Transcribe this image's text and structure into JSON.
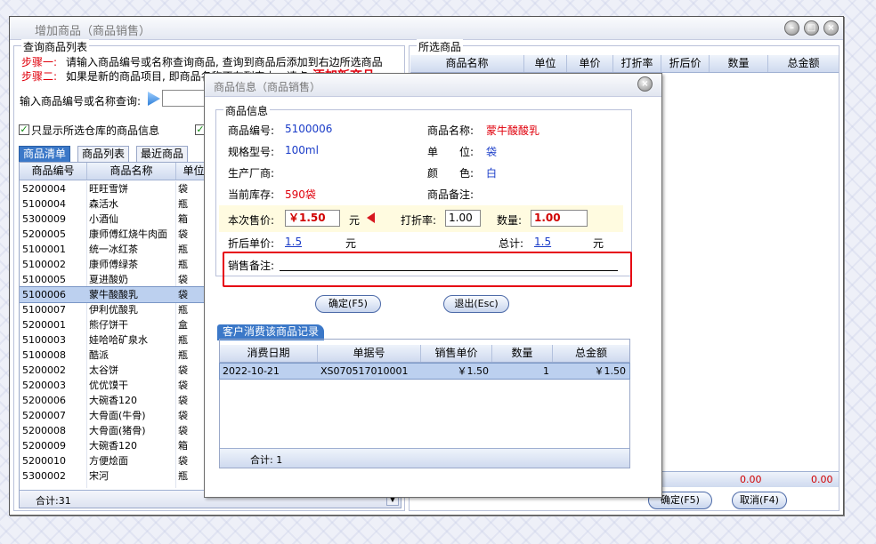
{
  "main": {
    "title": "增加商品（商品销售）",
    "query_group_title": "查询商品列表",
    "step1_label": "步骤一:",
    "step1_text": "请输入商品编号或名称查询商品, 查询到商品后添加到右边所选商品",
    "step2_label": "步骤二:",
    "step2_text": "如果是新的商品项目, 即商品名称不在列表中，请点",
    "add_new_link": "添加新商品",
    "search_label": "输入商品编号或名称查询:",
    "search_value": "",
    "checkbox_label": "只显示所选仓库的商品信息",
    "tabs": [
      "商品清单",
      "商品列表",
      "最近商品"
    ],
    "list_headers": [
      "商品编号",
      "商品名称",
      "单位"
    ],
    "list_rows": [
      {
        "code": "5200004",
        "name": "旺旺雪饼",
        "unit": "袋"
      },
      {
        "code": "5100004",
        "name": "森活水",
        "unit": "瓶"
      },
      {
        "code": "5300009",
        "name": "小酒仙",
        "unit": "箱"
      },
      {
        "code": "5200005",
        "name": "康师傅红烧牛肉面",
        "unit": "袋"
      },
      {
        "code": "5100001",
        "name": "统一冰红茶",
        "unit": "瓶"
      },
      {
        "code": "5100002",
        "name": "康师傅绿茶",
        "unit": "瓶"
      },
      {
        "code": "5100005",
        "name": "夏进酸奶",
        "unit": "袋"
      },
      {
        "code": "5100006",
        "name": "蒙牛酸酸乳",
        "unit": "袋"
      },
      {
        "code": "5100007",
        "name": "伊利优酸乳",
        "unit": "瓶"
      },
      {
        "code": "5200001",
        "name": "熊仔饼干",
        "unit": "盒"
      },
      {
        "code": "5100003",
        "name": "娃哈哈矿泉水",
        "unit": "瓶"
      },
      {
        "code": "5100008",
        "name": "酷派",
        "unit": "瓶"
      },
      {
        "code": "5200002",
        "name": "太谷饼",
        "unit": "袋"
      },
      {
        "code": "5200003",
        "name": "优优馍干",
        "unit": "袋"
      },
      {
        "code": "5200006",
        "name": "大碗香120",
        "unit": "袋"
      },
      {
        "code": "5200007",
        "name": "大骨面(牛骨)",
        "unit": "袋"
      },
      {
        "code": "5200008",
        "name": "大骨面(猪骨)",
        "unit": "袋"
      },
      {
        "code": "5200009",
        "name": "大碗香120",
        "unit": "箱"
      },
      {
        "code": "5200010",
        "name": "方便烩面",
        "unit": "袋"
      },
      {
        "code": "5300002",
        "name": "宋河",
        "unit": "瓶"
      }
    ],
    "selected_row_index": 7,
    "list_total": "合计:31",
    "selected_group_title": "所选商品",
    "selected_headers": [
      "商品名称",
      "单位",
      "单价",
      "打折率",
      "折后价",
      "数量",
      "总金额"
    ],
    "selected_total_qty": "0.00",
    "selected_total_amount": "0.00",
    "confirm_button": "确定(F5)",
    "cancel_button": "取消(F4)"
  },
  "dialog": {
    "title": "商品信息（商品销售）",
    "group_title": "商品信息",
    "code_label": "商品编号:",
    "code_value": "5100006",
    "name_label": "商品名称:",
    "name_value": "蒙牛酸酸乳",
    "spec_label": "规格型号:",
    "spec_value": "100ml",
    "unit_label": "单　　位:",
    "unit_value": "袋",
    "maker_label": "生产厂商:",
    "maker_value": "",
    "color_label": "颜　　色:",
    "color_value": "白",
    "stock_label": "当前库存:",
    "stock_value": "590袋",
    "remark_label": "商品备注:",
    "remark_value": "",
    "price_label": "本次售价:",
    "price_value": "￥1.50",
    "price_unit": "元",
    "discount_label": "打折率:",
    "discount_value": "1.00",
    "qty_label": "数量:",
    "qty_value": "1.00",
    "after_price_label": "折后单价:",
    "after_price_value": "1.5",
    "after_price_unit": "元",
    "total_label": "总计:",
    "total_value": "1.5",
    "total_unit": "元",
    "note_label": "销售备注:",
    "note_value": "",
    "ok_button": "确定(F5)",
    "exit_button": "退出(Esc)",
    "history_tab": "客户消费该商品记录",
    "history_headers": [
      "消费日期",
      "单据号",
      "销售单价",
      "数量",
      "总金额"
    ],
    "history_rows": [
      {
        "date": "2022-10-21",
        "bill": "XS070517010001",
        "price": "￥1.50",
        "qty": "1",
        "amount": "￥1.50"
      }
    ],
    "history_total": "合计: 1"
  }
}
